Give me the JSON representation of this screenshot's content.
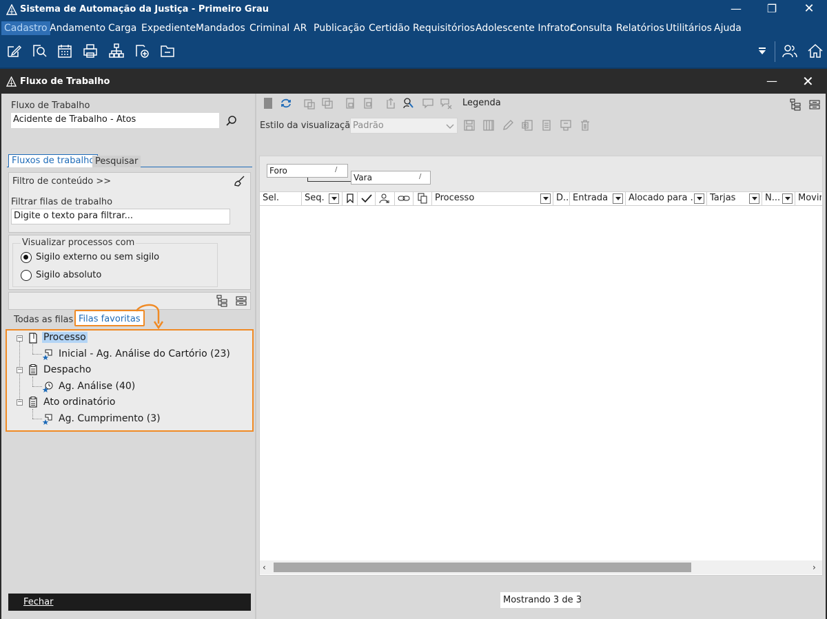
{
  "app": {
    "title": "Sistema de Automação da Justiça - Primeiro Grau",
    "menu": [
      "Cadastro",
      "Andamento",
      "Carga",
      "Expediente",
      "Mandados",
      "Criminal",
      "AR",
      "Publicação",
      "Certidão",
      "Requisitórios",
      "Adolescente Infrator",
      "Consulta",
      "Relatórios",
      "Utilitários",
      "Ajuda"
    ],
    "toolbar_icons": [
      "edit-icon",
      "search-document-icon",
      "calendar-icon",
      "printer-icon",
      "org-chart-icon",
      "add-queue-icon",
      "folder-icon"
    ],
    "right_icons": [
      "dropdown-arrow-icon",
      "users-icon",
      "home-icon"
    ],
    "colors": {
      "titlebar": "#10457a",
      "active_menu": "#2f6fb5",
      "highlight": "#f08a24"
    }
  },
  "window": {
    "title": "Fluxo de Trabalho"
  },
  "left": {
    "workflow_label": "Fluxo de Trabalho",
    "workflow_value": "Acidente de Trabalho - Atos",
    "tabs": [
      "Fluxos de trabalho",
      "Pesquisar"
    ],
    "filter_toggle": "Filtro de conteúdo >>",
    "filter_queues_label": "Filtrar filas de trabalho",
    "filter_placeholder": "Digite o texto para filtrar...",
    "visibility_group": "Visualizar processos com",
    "radio_options": [
      "Sigilo externo ou sem sigilo",
      "Sigilo absoluto"
    ],
    "radio_selected": 0,
    "queue_tabs": [
      "Todas as filas",
      "Filas favoritas"
    ],
    "tree": [
      {
        "label": "Processo",
        "child": "Inicial - Ag. Análise do Cartório (23)"
      },
      {
        "label": "Despacho",
        "child": "Ag. Análise (40)"
      },
      {
        "label": "Ato ordinatório",
        "child": "Ag. Cumprimento (3)"
      }
    ],
    "close_button": "Fechar"
  },
  "right": {
    "legend": "Legenda",
    "view_style_label": "Estilo da visualização",
    "view_style_value": "Padrão",
    "group_chips": [
      "Foro",
      "Vara"
    ],
    "columns": [
      "Sel.",
      "Seq.",
      "Processo",
      "D...",
      "Entrada",
      "Alocado para ...",
      "Tarjas",
      "N...",
      "Movir"
    ],
    "status": "Mostrando 3 de 3"
  }
}
